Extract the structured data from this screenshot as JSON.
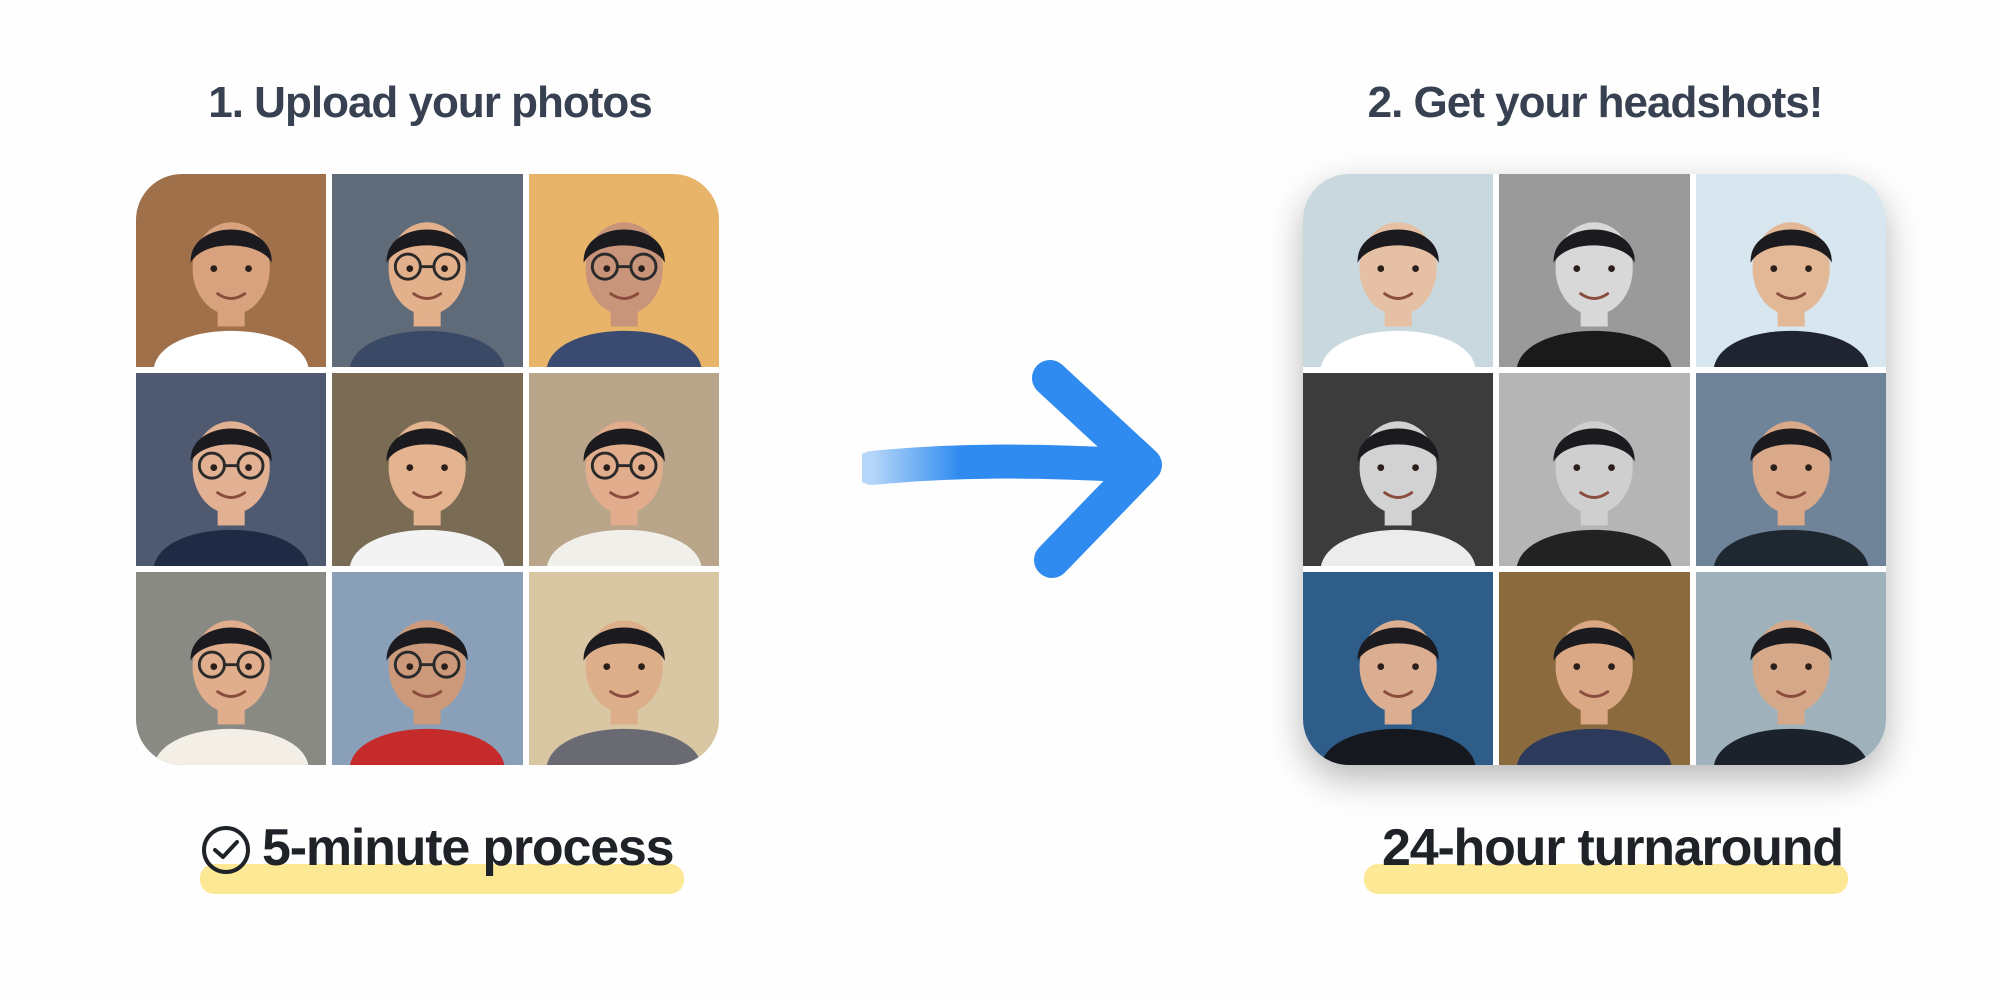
{
  "steps": {
    "upload_title": "1. Upload your photos",
    "result_title": "2. Get your headshots!"
  },
  "captions": {
    "left": "5-minute process",
    "right": "24-hour turnaround",
    "left_icon": "clock-check-icon",
    "highlight_color": "#fde68a"
  },
  "arrow": {
    "icon": "right-arrow-icon",
    "color": "#2f8bf0"
  },
  "uploaded_photos": [
    {
      "bg": "#a0704a",
      "shirt": "#ffffff",
      "skin": "#d9a27e",
      "glasses": false
    },
    {
      "bg": "#5f6b78",
      "shirt": "#3a4a66",
      "skin": "#e3b08c",
      "glasses": true
    },
    {
      "bg": "#e7b46a",
      "shirt": "#3b4a70",
      "skin": "#c8957a",
      "glasses": true
    },
    {
      "bg": "#4f5a70",
      "shirt": "#1f2a44",
      "skin": "#e2b193",
      "glasses": true
    },
    {
      "bg": "#7a6b55",
      "shirt": "#f3f3f3",
      "skin": "#e4b38f",
      "glasses": false
    },
    {
      "bg": "#b8a58a",
      "shirt": "#f1efe9",
      "skin": "#e2ad8c",
      "glasses": true
    },
    {
      "bg": "#8a8a84",
      "shirt": "#f4efe6",
      "skin": "#e0ae8c",
      "glasses": true
    },
    {
      "bg": "#8aa0b8",
      "shirt": "#c62b2b",
      "skin": "#cc9a7a",
      "glasses": true
    },
    {
      "bg": "#d8c7a2",
      "shirt": "#6a6a72",
      "skin": "#dcae8a",
      "glasses": false
    }
  ],
  "headshots": [
    {
      "bg": "#c9d8de",
      "shirt": "#ffffff",
      "skin": "#e6c0a4",
      "glasses": false
    },
    {
      "bg": "#9a9a9a",
      "shirt": "#1a1a1a",
      "skin": "#d8d8d8",
      "glasses": false
    },
    {
      "bg": "#d7e6ef",
      "shirt": "#1e2430",
      "skin": "#e2b896",
      "glasses": false
    },
    {
      "bg": "#3c3c3c",
      "shirt": "#ececec",
      "skin": "#d2d2d2",
      "glasses": false
    },
    {
      "bg": "#b5b5b5",
      "shirt": "#222222",
      "skin": "#cfcfcf",
      "glasses": false
    },
    {
      "bg": "#6f8399",
      "shirt": "#1f2730",
      "skin": "#d9a98a",
      "glasses": false
    },
    {
      "bg": "#2f5d8a",
      "shirt": "#15181e",
      "skin": "#dcae91",
      "glasses": false
    },
    {
      "bg": "#8b6b3e",
      "shirt": "#2d3a5c",
      "skin": "#dba886",
      "glasses": false
    },
    {
      "bg": "#9fb2bb",
      "shirt": "#1b222b",
      "skin": "#d6a88a",
      "glasses": false
    }
  ]
}
